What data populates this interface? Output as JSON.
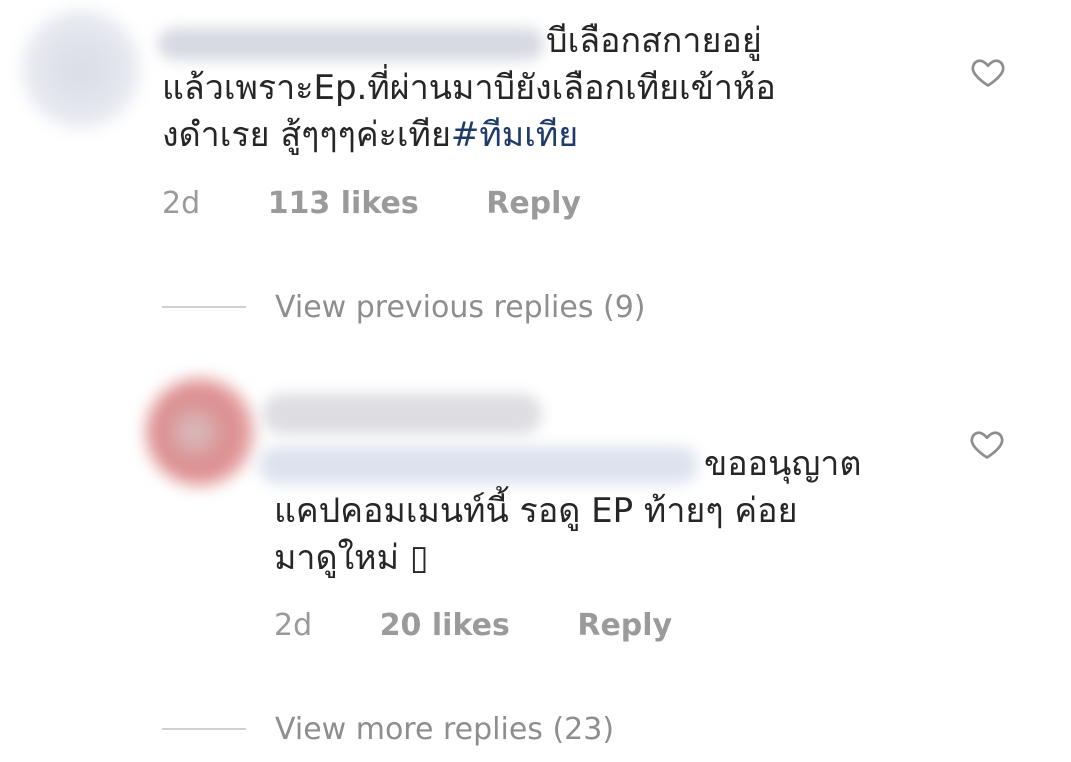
{
  "comments": [
    {
      "id": "main",
      "lines": [
        "บีเลือกสกายอยู่",
        "แล้วเพราะEp.ที่ผ่านมาบียังเลือกเทียเข้าห้อ",
        "งดำเรย สู้ๆๆๆค่ะเทีย"
      ],
      "hashtag": "#ทีมเทีย",
      "time": "2d",
      "likes": "113 likes",
      "reply_label": "Reply",
      "heart_icon": "heart-outline-icon"
    },
    {
      "id": "reply",
      "lines": [
        "ขออนุญาต",
        "แคปคอมเมนท์นี้ รอดู EP ท้ายๆ ค่อย",
        "มาดูใหม่ "
      ],
      "emoji_placeholder": "▯",
      "time": "2d",
      "likes": "20 likes",
      "reply_label": "Reply",
      "heart_icon": "heart-outline-icon"
    }
  ],
  "threads": {
    "previous_replies": "View previous replies (9)",
    "more_replies": "View more replies (23)"
  },
  "colors": {
    "text": "#262626",
    "meta": "#9a9a9a",
    "hashtag": "#1f3b6b",
    "thread_line": "#d0d0d0"
  }
}
